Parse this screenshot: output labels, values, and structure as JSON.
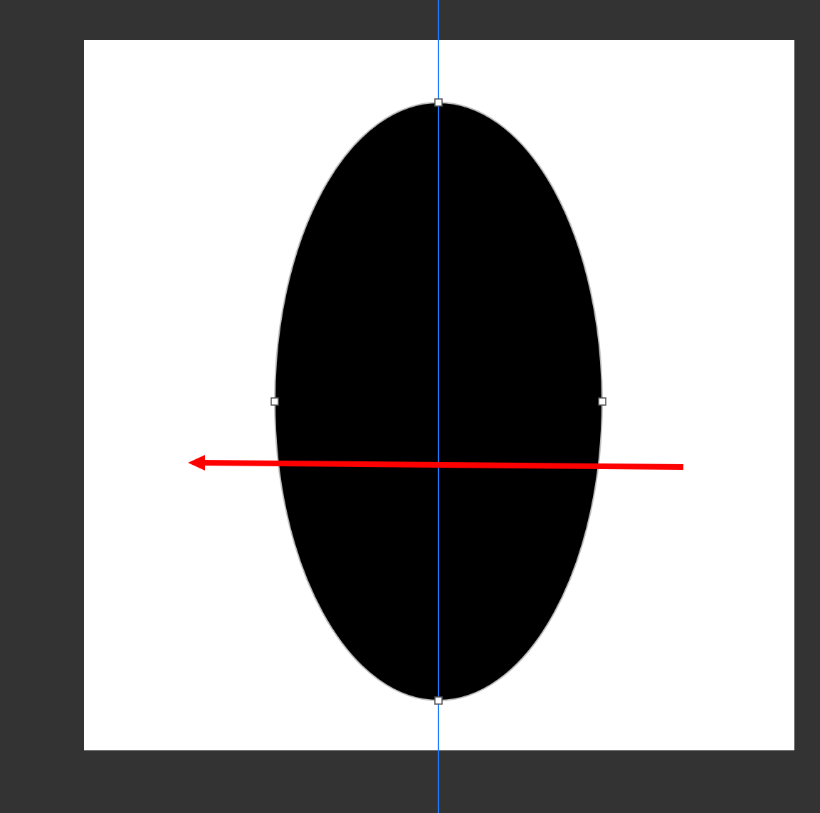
{
  "shape": {
    "kind": "ellipse",
    "selected": true
  },
  "guides": [
    {
      "kind": "vertical"
    }
  ],
  "arrow": {
    "kind": "left"
  }
}
